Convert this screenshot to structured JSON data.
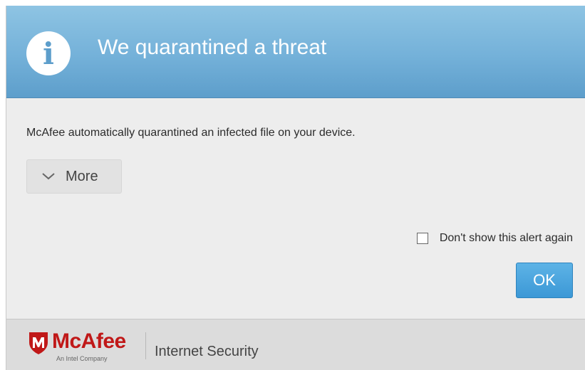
{
  "header": {
    "icon": "info-icon",
    "icon_glyph": "i",
    "title": "We quarantined a threat",
    "colors": {
      "top": "#8ec4e3",
      "bottom": "#5d9ecb"
    }
  },
  "body": {
    "message": "McAfee automatically quarantined an infected file on your device.",
    "more_button": {
      "icon": "chevron-down-icon",
      "label": "More"
    },
    "dont_show_checkbox": {
      "label": "Don't show this alert again",
      "checked": false
    },
    "ok_button": {
      "label": "OK",
      "color": "#3c98d6"
    }
  },
  "footer": {
    "brand": {
      "icon": "mcafee-shield-icon",
      "name": "McAfee",
      "tagline": "An Intel Company",
      "color": "#c01818"
    },
    "product_name": "Internet Security"
  }
}
